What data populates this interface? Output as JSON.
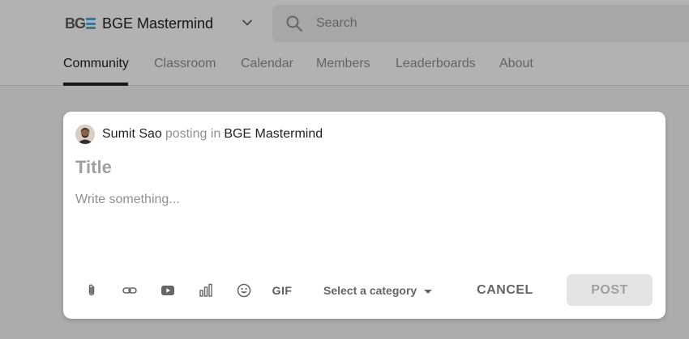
{
  "header": {
    "logo_text": "BG",
    "group_name": "BGE Mastermind",
    "search_placeholder": "Search"
  },
  "tabs": [
    {
      "label": "Community",
      "active": true
    },
    {
      "label": "Classroom",
      "active": false
    },
    {
      "label": "Calendar",
      "active": false
    },
    {
      "label": "Members",
      "active": false
    },
    {
      "label": "Leaderboards",
      "active": false
    },
    {
      "label": "About",
      "active": false
    }
  ],
  "composer": {
    "author_name": "Sumit Sao",
    "posting_in": "posting in",
    "group": "BGE Mastermind",
    "title_placeholder": "Title",
    "body_placeholder": "Write something...",
    "toolbar_icons": [
      "attachment-icon",
      "link-icon",
      "video-icon",
      "poll-icon",
      "emoji-icon",
      "gif-icon"
    ],
    "gif_label": "GIF",
    "category_placeholder": "Select a category",
    "cancel_label": "CANCEL",
    "post_label": "POST"
  },
  "colors": {
    "overlay": "rgba(0,0,0,0.30)",
    "logo_accent": "#5aa9d6",
    "post_disabled_bg": "#e4e4e4"
  }
}
